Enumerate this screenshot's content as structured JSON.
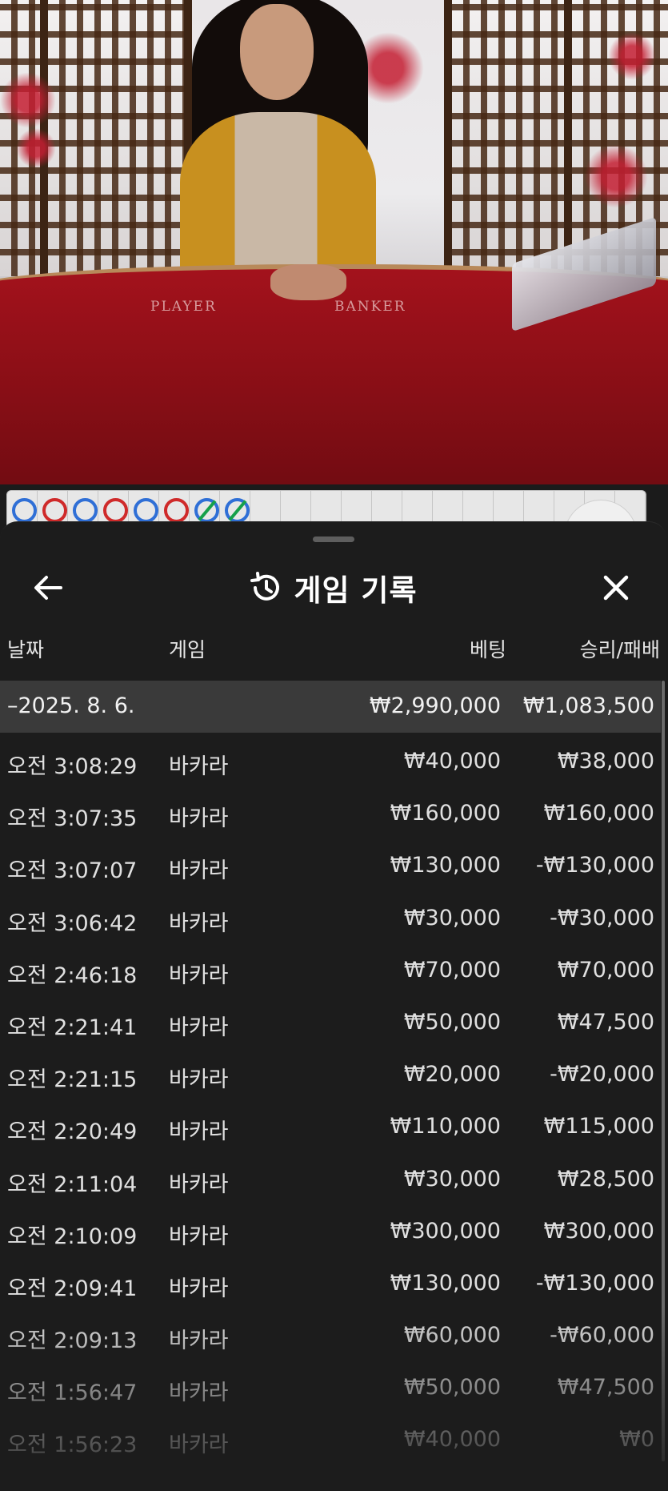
{
  "header": {
    "title": "게임 기록",
    "back_icon": "arrow-left-icon",
    "history_icon": "history-clock-icon",
    "close_icon": "close-icon"
  },
  "table_felt": {
    "player_label": "PLAYER",
    "banker_label": "BANKER"
  },
  "bead_road": [
    "player",
    "banker",
    "player",
    "banker",
    "player",
    "banker",
    "tie",
    "tie"
  ],
  "columns": {
    "date": "날짜",
    "game": "게임",
    "bet": "베팅",
    "result": "승리/패배"
  },
  "summary": {
    "date": "–2025. 8. 6.",
    "bet": "₩2,990,000",
    "result": "₩1,083,500"
  },
  "rows": [
    {
      "time": "오전 3:08:29",
      "game": "바카라",
      "bet": "₩40,000",
      "result": "₩38,000"
    },
    {
      "time": "오전 3:07:35",
      "game": "바카라",
      "bet": "₩160,000",
      "result": "₩160,000"
    },
    {
      "time": "오전 3:07:07",
      "game": "바카라",
      "bet": "₩130,000",
      "result": "-₩130,000"
    },
    {
      "time": "오전 3:06:42",
      "game": "바카라",
      "bet": "₩30,000",
      "result": "-₩30,000"
    },
    {
      "time": "오전 2:46:18",
      "game": "바카라",
      "bet": "₩70,000",
      "result": "₩70,000"
    },
    {
      "time": "오전 2:21:41",
      "game": "바카라",
      "bet": "₩50,000",
      "result": "₩47,500"
    },
    {
      "time": "오전 2:21:15",
      "game": "바카라",
      "bet": "₩20,000",
      "result": "-₩20,000"
    },
    {
      "time": "오전 2:20:49",
      "game": "바카라",
      "bet": "₩110,000",
      "result": "₩115,000"
    },
    {
      "time": "오전 2:11:04",
      "game": "바카라",
      "bet": "₩30,000",
      "result": "₩28,500"
    },
    {
      "time": "오전 2:10:09",
      "game": "바카라",
      "bet": "₩300,000",
      "result": "₩300,000"
    },
    {
      "time": "오전 2:09:41",
      "game": "바카라",
      "bet": "₩130,000",
      "result": "-₩130,000"
    },
    {
      "time": "오전 2:09:13",
      "game": "바카라",
      "bet": "₩60,000",
      "result": "-₩60,000"
    },
    {
      "time": "오전 1:56:47",
      "game": "바카라",
      "bet": "₩50,000",
      "result": "₩47,500"
    },
    {
      "time": "오전 1:56:23",
      "game": "바카라",
      "bet": "₩40,000",
      "result": "₩0"
    }
  ],
  "colors": {
    "panel_bg": "#1c1c1c",
    "summary_bg": "#3a3a3a",
    "text": "#e0e0e0",
    "player_blue": "#2f6fd6",
    "banker_red": "#cf2a2a",
    "tie_green": "#16a04a",
    "felt_red": "#9a111a"
  }
}
